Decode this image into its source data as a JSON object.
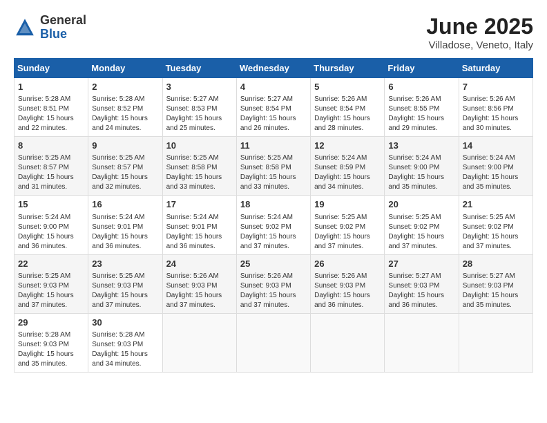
{
  "header": {
    "logo_general": "General",
    "logo_blue": "Blue",
    "title": "June 2025",
    "subtitle": "Villadose, Veneto, Italy"
  },
  "weekdays": [
    "Sunday",
    "Monday",
    "Tuesday",
    "Wednesday",
    "Thursday",
    "Friday",
    "Saturday"
  ],
  "weeks": [
    [
      {
        "day": "1",
        "lines": [
          "Sunrise: 5:28 AM",
          "Sunset: 8:51 PM",
          "Daylight: 15 hours",
          "and 22 minutes."
        ]
      },
      {
        "day": "2",
        "lines": [
          "Sunrise: 5:28 AM",
          "Sunset: 8:52 PM",
          "Daylight: 15 hours",
          "and 24 minutes."
        ]
      },
      {
        "day": "3",
        "lines": [
          "Sunrise: 5:27 AM",
          "Sunset: 8:53 PM",
          "Daylight: 15 hours",
          "and 25 minutes."
        ]
      },
      {
        "day": "4",
        "lines": [
          "Sunrise: 5:27 AM",
          "Sunset: 8:54 PM",
          "Daylight: 15 hours",
          "and 26 minutes."
        ]
      },
      {
        "day": "5",
        "lines": [
          "Sunrise: 5:26 AM",
          "Sunset: 8:54 PM",
          "Daylight: 15 hours",
          "and 28 minutes."
        ]
      },
      {
        "day": "6",
        "lines": [
          "Sunrise: 5:26 AM",
          "Sunset: 8:55 PM",
          "Daylight: 15 hours",
          "and 29 minutes."
        ]
      },
      {
        "day": "7",
        "lines": [
          "Sunrise: 5:26 AM",
          "Sunset: 8:56 PM",
          "Daylight: 15 hours",
          "and 30 minutes."
        ]
      }
    ],
    [
      {
        "day": "8",
        "lines": [
          "Sunrise: 5:25 AM",
          "Sunset: 8:57 PM",
          "Daylight: 15 hours",
          "and 31 minutes."
        ]
      },
      {
        "day": "9",
        "lines": [
          "Sunrise: 5:25 AM",
          "Sunset: 8:57 PM",
          "Daylight: 15 hours",
          "and 32 minutes."
        ]
      },
      {
        "day": "10",
        "lines": [
          "Sunrise: 5:25 AM",
          "Sunset: 8:58 PM",
          "Daylight: 15 hours",
          "and 33 minutes."
        ]
      },
      {
        "day": "11",
        "lines": [
          "Sunrise: 5:25 AM",
          "Sunset: 8:58 PM",
          "Daylight: 15 hours",
          "and 33 minutes."
        ]
      },
      {
        "day": "12",
        "lines": [
          "Sunrise: 5:24 AM",
          "Sunset: 8:59 PM",
          "Daylight: 15 hours",
          "and 34 minutes."
        ]
      },
      {
        "day": "13",
        "lines": [
          "Sunrise: 5:24 AM",
          "Sunset: 9:00 PM",
          "Daylight: 15 hours",
          "and 35 minutes."
        ]
      },
      {
        "day": "14",
        "lines": [
          "Sunrise: 5:24 AM",
          "Sunset: 9:00 PM",
          "Daylight: 15 hours",
          "and 35 minutes."
        ]
      }
    ],
    [
      {
        "day": "15",
        "lines": [
          "Sunrise: 5:24 AM",
          "Sunset: 9:00 PM",
          "Daylight: 15 hours",
          "and 36 minutes."
        ]
      },
      {
        "day": "16",
        "lines": [
          "Sunrise: 5:24 AM",
          "Sunset: 9:01 PM",
          "Daylight: 15 hours",
          "and 36 minutes."
        ]
      },
      {
        "day": "17",
        "lines": [
          "Sunrise: 5:24 AM",
          "Sunset: 9:01 PM",
          "Daylight: 15 hours",
          "and 36 minutes."
        ]
      },
      {
        "day": "18",
        "lines": [
          "Sunrise: 5:24 AM",
          "Sunset: 9:02 PM",
          "Daylight: 15 hours",
          "and 37 minutes."
        ]
      },
      {
        "day": "19",
        "lines": [
          "Sunrise: 5:25 AM",
          "Sunset: 9:02 PM",
          "Daylight: 15 hours",
          "and 37 minutes."
        ]
      },
      {
        "day": "20",
        "lines": [
          "Sunrise: 5:25 AM",
          "Sunset: 9:02 PM",
          "Daylight: 15 hours",
          "and 37 minutes."
        ]
      },
      {
        "day": "21",
        "lines": [
          "Sunrise: 5:25 AM",
          "Sunset: 9:02 PM",
          "Daylight: 15 hours",
          "and 37 minutes."
        ]
      }
    ],
    [
      {
        "day": "22",
        "lines": [
          "Sunrise: 5:25 AM",
          "Sunset: 9:03 PM",
          "Daylight: 15 hours",
          "and 37 minutes."
        ]
      },
      {
        "day": "23",
        "lines": [
          "Sunrise: 5:25 AM",
          "Sunset: 9:03 PM",
          "Daylight: 15 hours",
          "and 37 minutes."
        ]
      },
      {
        "day": "24",
        "lines": [
          "Sunrise: 5:26 AM",
          "Sunset: 9:03 PM",
          "Daylight: 15 hours",
          "and 37 minutes."
        ]
      },
      {
        "day": "25",
        "lines": [
          "Sunrise: 5:26 AM",
          "Sunset: 9:03 PM",
          "Daylight: 15 hours",
          "and 37 minutes."
        ]
      },
      {
        "day": "26",
        "lines": [
          "Sunrise: 5:26 AM",
          "Sunset: 9:03 PM",
          "Daylight: 15 hours",
          "and 36 minutes."
        ]
      },
      {
        "day": "27",
        "lines": [
          "Sunrise: 5:27 AM",
          "Sunset: 9:03 PM",
          "Daylight: 15 hours",
          "and 36 minutes."
        ]
      },
      {
        "day": "28",
        "lines": [
          "Sunrise: 5:27 AM",
          "Sunset: 9:03 PM",
          "Daylight: 15 hours",
          "and 35 minutes."
        ]
      }
    ],
    [
      {
        "day": "29",
        "lines": [
          "Sunrise: 5:28 AM",
          "Sunset: 9:03 PM",
          "Daylight: 15 hours",
          "and 35 minutes."
        ]
      },
      {
        "day": "30",
        "lines": [
          "Sunrise: 5:28 AM",
          "Sunset: 9:03 PM",
          "Daylight: 15 hours",
          "and 34 minutes."
        ]
      },
      null,
      null,
      null,
      null,
      null
    ]
  ]
}
